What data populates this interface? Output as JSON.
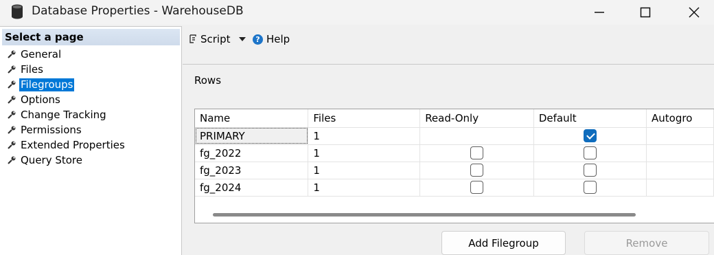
{
  "window": {
    "title": "Database Properties - WarehouseDB"
  },
  "left_pane": {
    "header": "Select a page",
    "items": [
      {
        "label": "General"
      },
      {
        "label": "Files"
      },
      {
        "label": "Filegroups",
        "selected": true
      },
      {
        "label": "Options"
      },
      {
        "label": "Change Tracking"
      },
      {
        "label": "Permissions"
      },
      {
        "label": "Extended Properties"
      },
      {
        "label": "Query Store"
      }
    ]
  },
  "toolbar": {
    "script_label": "Script",
    "help_label": "Help"
  },
  "main": {
    "section_label": "Rows",
    "grid": {
      "columns": [
        "Name",
        "Files",
        "Read-Only",
        "Default",
        "Autogro"
      ],
      "rows": [
        {
          "name": "PRIMARY",
          "files": "1",
          "read_only": null,
          "default": true
        },
        {
          "name": "fg_2022",
          "files": "1",
          "read_only": false,
          "default": false
        },
        {
          "name": "fg_2023",
          "files": "1",
          "read_only": false,
          "default": false
        },
        {
          "name": "fg_2024",
          "files": "1",
          "read_only": false,
          "default": false
        }
      ]
    },
    "buttons": {
      "add": "Add Filegroup",
      "remove": "Remove"
    }
  },
  "colors": {
    "selection": "#0078d7",
    "checkbox_checked": "#0f6cbd",
    "page_header": "#d5e1ef"
  }
}
